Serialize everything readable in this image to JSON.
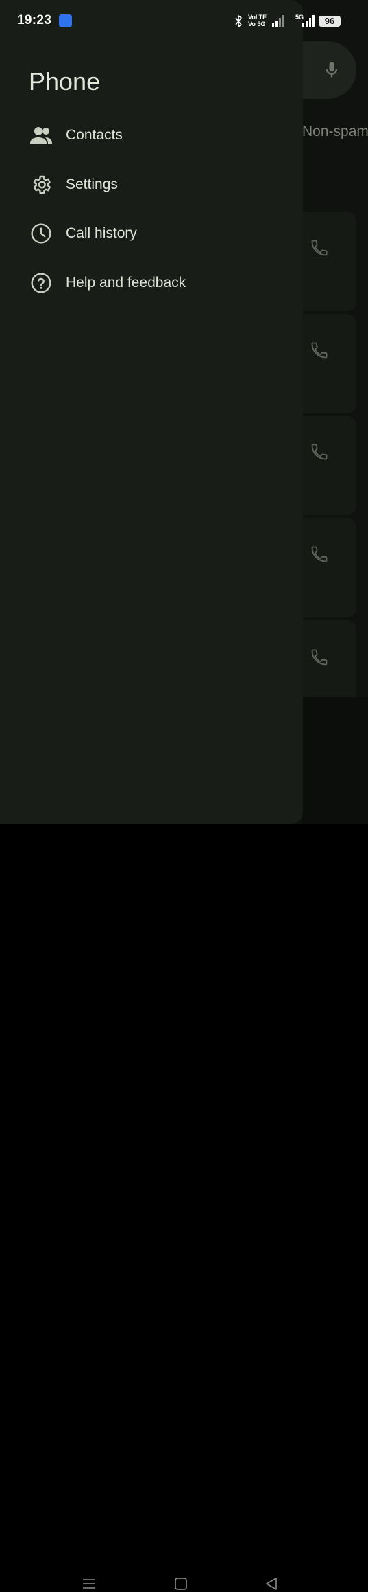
{
  "status_bar": {
    "time": "19:23",
    "volte_line1": "VoLTE",
    "volte_line2": "Vo 5G",
    "network_label": "5G",
    "battery": "96"
  },
  "drawer": {
    "title": "Phone",
    "items": [
      {
        "label": "Contacts",
        "icon": "contacts-icon"
      },
      {
        "label": "Settings",
        "icon": "gear-icon"
      },
      {
        "label": "Call history",
        "icon": "clock-icon"
      },
      {
        "label": "Help and feedback",
        "icon": "help-icon"
      }
    ]
  },
  "background": {
    "filter_chip": "Non-spam"
  },
  "colors": {
    "drawer_bg": "#181e17",
    "text": "#dfe4d7",
    "app_badge": "#2f73ee"
  }
}
